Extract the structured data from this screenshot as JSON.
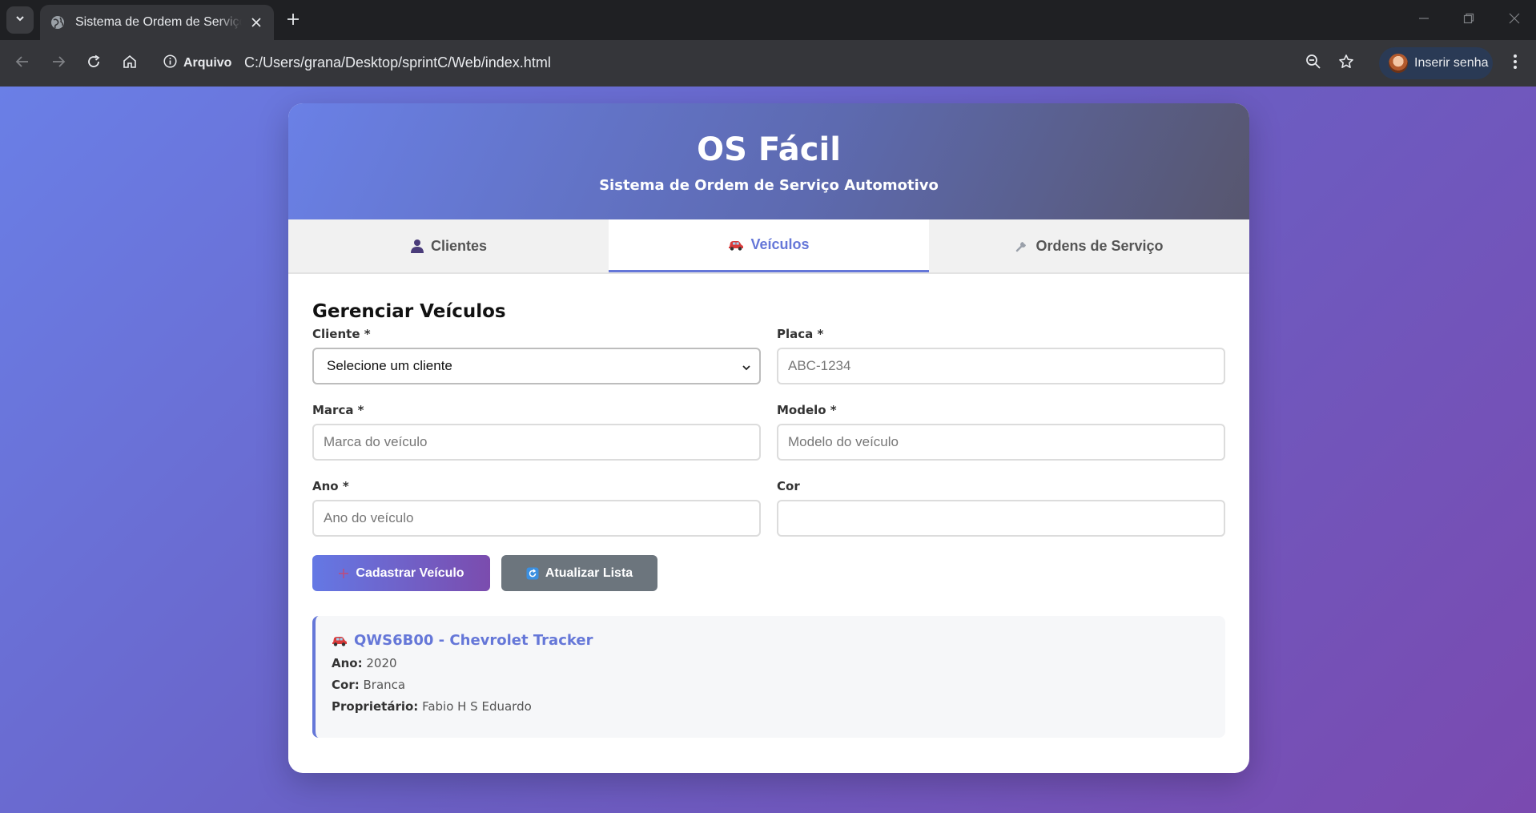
{
  "browser": {
    "tab_title": "Sistema de Ordem de Serviço Automotivo",
    "security_label": "Arquivo",
    "url": "C:/Users/grana/Desktop/sprintC/Web/index.html",
    "profile_label": "Inserir senha"
  },
  "app": {
    "title": "OS Fácil",
    "subtitle": "Sistema de Ordem de Serviço Automotivo"
  },
  "tabs": [
    {
      "label": "Clientes",
      "icon": "person-icon",
      "active": false
    },
    {
      "label": "Veículos",
      "icon": "car-icon",
      "active": true
    },
    {
      "label": "Ordens de Serviço",
      "icon": "wrench-icon",
      "active": false
    }
  ],
  "section": {
    "title": "Gerenciar Veículos"
  },
  "form": {
    "cliente": {
      "label": "Cliente *",
      "selected": "Selecione um cliente"
    },
    "placa": {
      "label": "Placa *",
      "placeholder": "ABC-1234",
      "value": ""
    },
    "marca": {
      "label": "Marca *",
      "placeholder": "Marca do veículo",
      "value": ""
    },
    "modelo": {
      "label": "Modelo *",
      "placeholder": "Modelo do veículo",
      "value": ""
    },
    "ano": {
      "label": "Ano *",
      "placeholder": "Ano do veículo",
      "value": ""
    },
    "cor": {
      "label": "Cor",
      "placeholder": "",
      "value": ""
    }
  },
  "buttons": {
    "cadastrar": "Cadastrar Veículo",
    "atualizar": "Atualizar Lista"
  },
  "vehicles": [
    {
      "title": "QWS6B00 - Chevrolet Tracker",
      "ano_label": "Ano:",
      "ano": "2020",
      "cor_label": "Cor:",
      "cor": "Branca",
      "proprietario_label": "Proprietário:",
      "proprietario": "Fabio H S Eduardo"
    }
  ],
  "colors": {
    "accent": "#6577d8",
    "secondary_button": "#6c757d",
    "gradient_start": "#6a7fe6",
    "gradient_end": "#7a4ab0"
  }
}
